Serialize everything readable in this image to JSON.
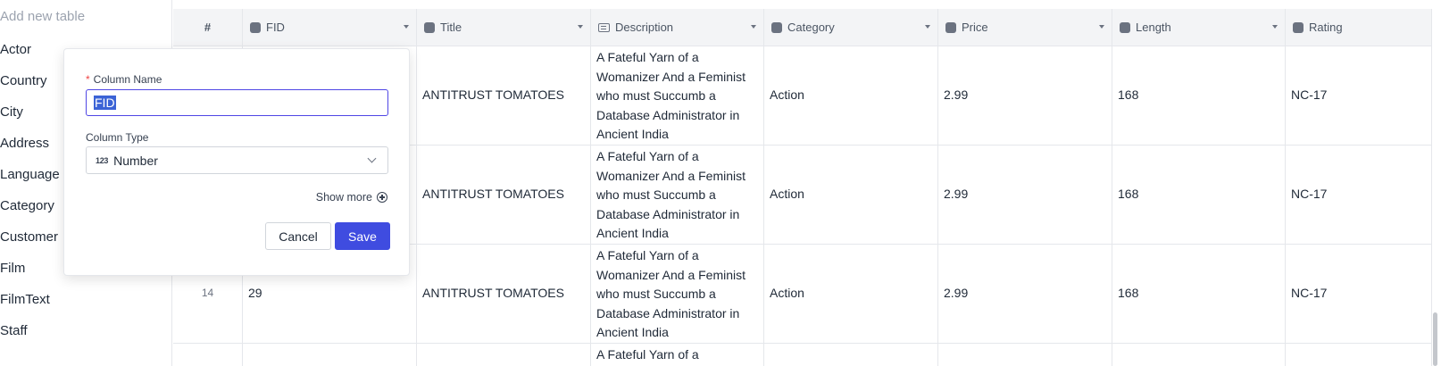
{
  "sidebar": {
    "add_table": "Add new table",
    "items": [
      {
        "label": "Actor"
      },
      {
        "label": "Country"
      },
      {
        "label": "City"
      },
      {
        "label": "Address"
      },
      {
        "label": "Language"
      },
      {
        "label": "Category"
      },
      {
        "label": "Customer"
      },
      {
        "label": "Film"
      },
      {
        "label": "FilmText"
      },
      {
        "label": "Staff"
      }
    ]
  },
  "grid": {
    "columns": {
      "num": "#",
      "fid": "FID",
      "title": "Title",
      "description": "Description",
      "category": "Category",
      "price": "Price",
      "length": "Length",
      "rating": "Rating"
    },
    "rows": [
      {
        "num": "",
        "fid": "",
        "title": "ANTITRUST TOMATOES",
        "description": "A Fateful Yarn of a Womanizer And a Feminist who must Succumb a Database Administrator in Ancient India",
        "category": "Action",
        "price": "2.99",
        "length": "168",
        "rating": "NC-17"
      },
      {
        "num": "",
        "fid": "",
        "title": "ANTITRUST TOMATOES",
        "description": "A Fateful Yarn of a Womanizer And a Feminist who must Succumb a Database Administrator in Ancient India",
        "category": "Action",
        "price": "2.99",
        "length": "168",
        "rating": "NC-17"
      },
      {
        "num": "14",
        "fid": "29",
        "title": "ANTITRUST TOMATOES",
        "description": "A Fateful Yarn of a Womanizer And a Feminist who must Succumb a Database Administrator in Ancient India",
        "category": "Action",
        "price": "2.99",
        "length": "168",
        "rating": "NC-17"
      },
      {
        "num": "",
        "fid": "",
        "title": "",
        "description": "A Fateful Yarn of a",
        "category": "",
        "price": "",
        "length": "",
        "rating": ""
      }
    ]
  },
  "popover": {
    "required_mark": "*",
    "column_name_label": "Column Name",
    "column_name_value": "FID",
    "column_type_label": "Column Type",
    "column_type_icon": "123",
    "column_type_value": "Number",
    "show_more": "Show more",
    "cancel": "Cancel",
    "save": "Save"
  },
  "colors": {
    "accent": "#3f4ce0",
    "selection": "#3b63d6",
    "required": "#ef4444"
  }
}
